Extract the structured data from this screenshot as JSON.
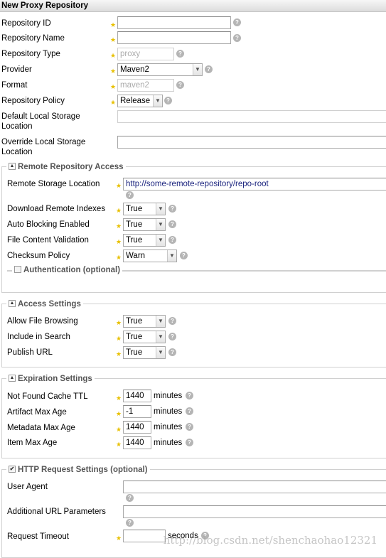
{
  "header": {
    "title": "New Proxy Repository"
  },
  "help_glyph": "?",
  "top_fields": {
    "repo_id": {
      "label": "Repository ID",
      "value": ""
    },
    "repo_name": {
      "label": "Repository Name",
      "value": ""
    },
    "repo_type": {
      "label": "Repository Type",
      "value": "proxy"
    },
    "provider": {
      "label": "Provider",
      "value": "Maven2"
    },
    "format": {
      "label": "Format",
      "value": "maven2"
    },
    "policy": {
      "label": "Repository Policy",
      "value": "Release"
    },
    "default_storage": {
      "label": "Default Local Storage Location",
      "value": ""
    },
    "override_storage": {
      "label": "Override Local Storage Location",
      "value": ""
    }
  },
  "remote": {
    "legend": "Remote Repository Access",
    "storage_location": {
      "label": "Remote Storage Location",
      "value": "http://some-remote-repository/repo-root"
    },
    "download_indexes": {
      "label": "Download Remote Indexes",
      "value": "True"
    },
    "auto_blocking": {
      "label": "Auto Blocking Enabled",
      "value": "True"
    },
    "file_validation": {
      "label": "File Content Validation",
      "value": "True"
    },
    "checksum_policy": {
      "label": "Checksum Policy",
      "value": "Warn"
    },
    "auth_legend": "Authentication (optional)"
  },
  "access": {
    "legend": "Access Settings",
    "file_browsing": {
      "label": "Allow File Browsing",
      "value": "True"
    },
    "include_search": {
      "label": "Include in Search",
      "value": "True"
    },
    "publish_url": {
      "label": "Publish URL",
      "value": "True"
    }
  },
  "expiration": {
    "legend": "Expiration Settings",
    "unit": "minutes",
    "not_found_ttl": {
      "label": "Not Found Cache TTL",
      "value": "1440"
    },
    "artifact_max_age": {
      "label": "Artifact Max Age",
      "value": "-1"
    },
    "metadata_max_age": {
      "label": "Metadata Max Age",
      "value": "1440"
    },
    "item_max_age": {
      "label": "Item Max Age",
      "value": "1440"
    }
  },
  "http": {
    "legend": "HTTP Request Settings (optional)",
    "user_agent": {
      "label": "User Agent",
      "value": ""
    },
    "url_params": {
      "label": "Additional URL Parameters",
      "value": ""
    },
    "timeout": {
      "label": "Request Timeout",
      "value": "",
      "unit": "seconds"
    }
  },
  "watermark": "http://blog.csdn.net/shenchaohao12321"
}
